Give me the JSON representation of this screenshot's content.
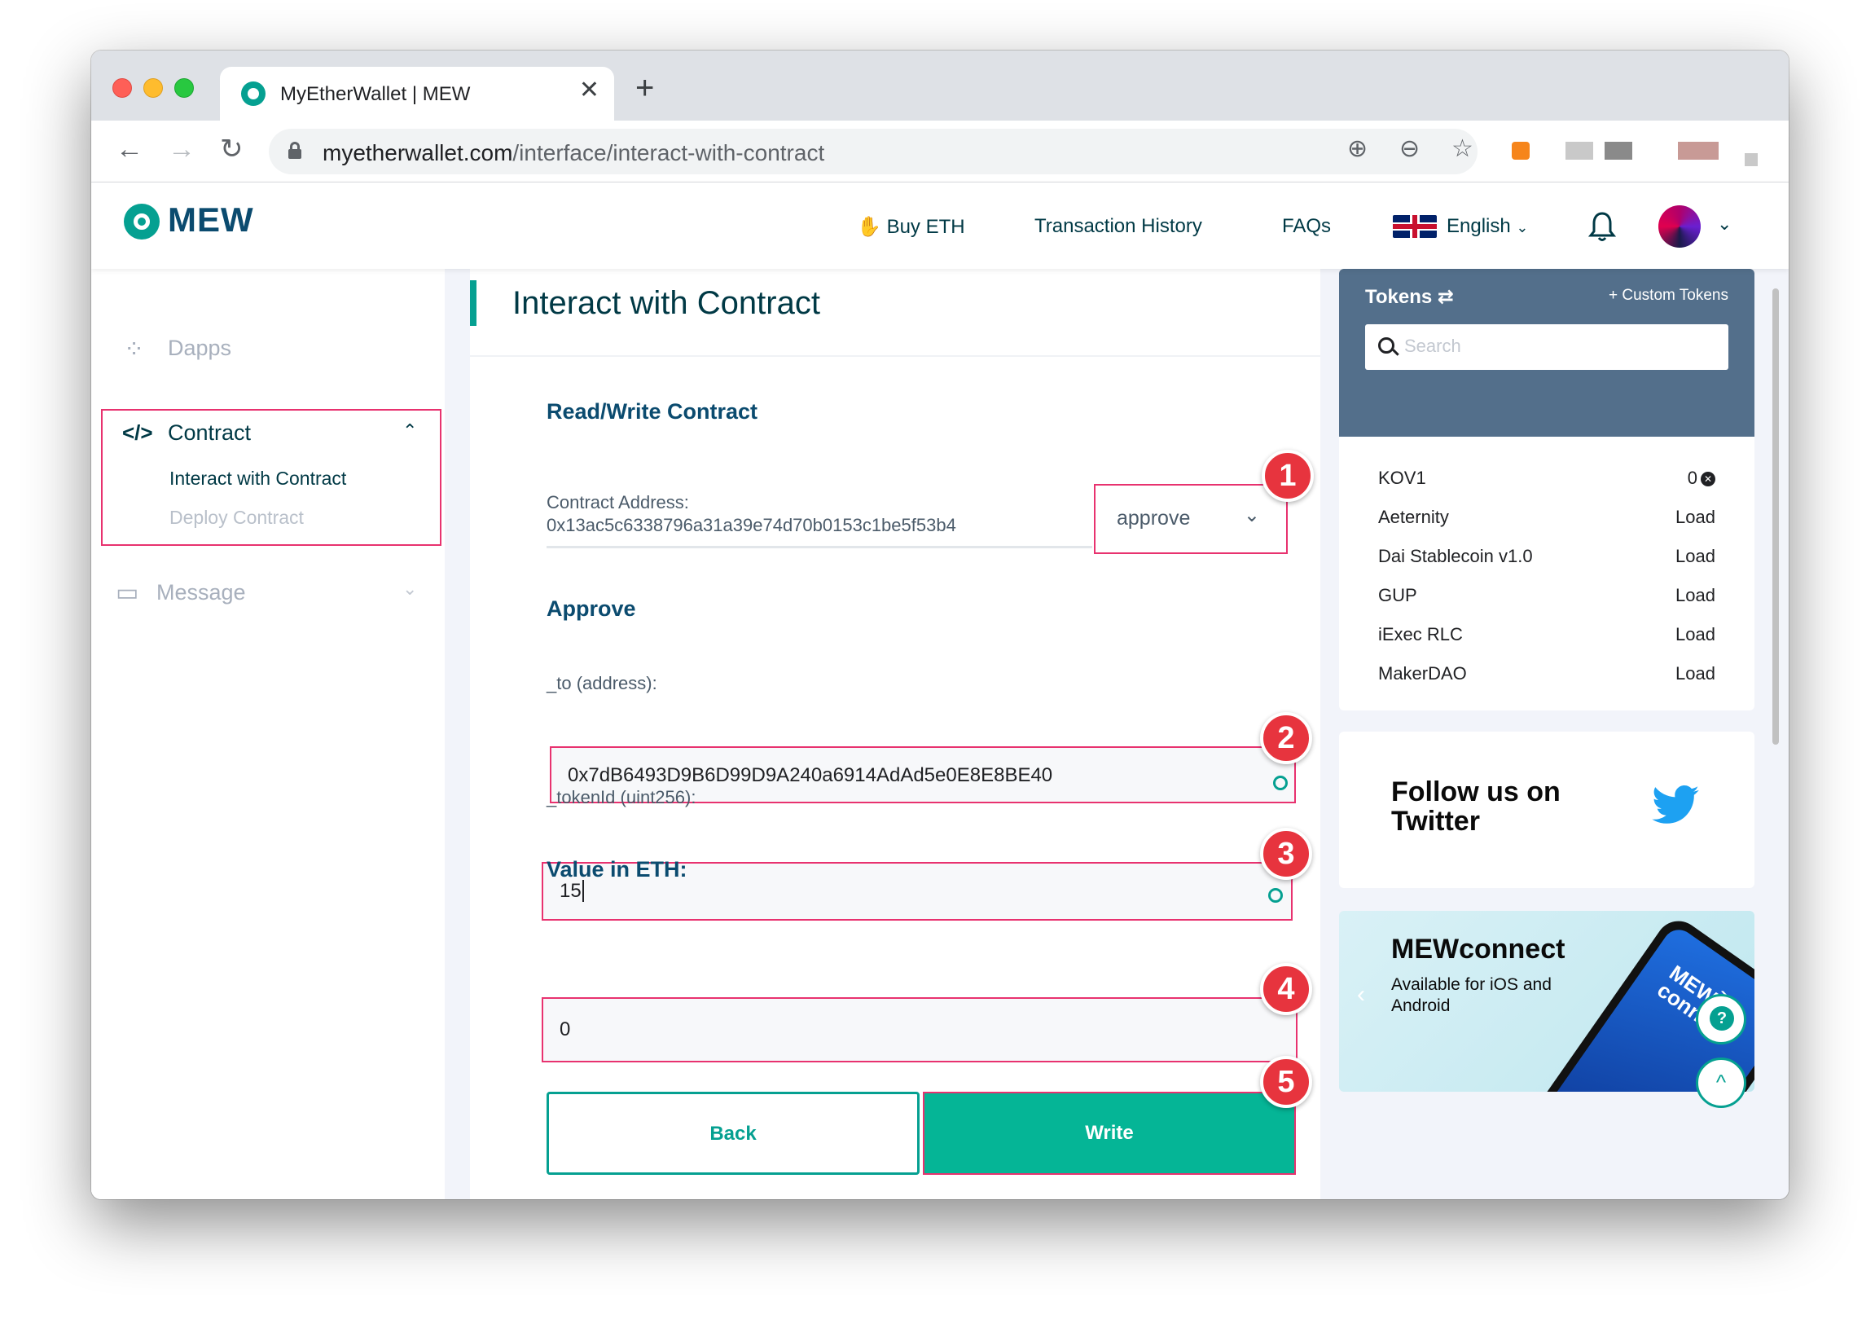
{
  "browser": {
    "tab_title": "MyEtherWallet | MEW",
    "tab_close": "✕",
    "new_tab": "+",
    "url_host": "myetherwallet.com",
    "url_path": "/interface/interact-with-contract"
  },
  "header": {
    "logo_text": "MEW",
    "buy_eth": "Buy ETH",
    "transaction_history": "Transaction History",
    "faqs": "FAQs",
    "language": "English"
  },
  "sidebar": {
    "dapps": "Dapps",
    "contract": "Contract",
    "interact_with_contract": "Interact with Contract",
    "deploy_contract": "Deploy Contract",
    "message": "Message"
  },
  "main": {
    "title": "Interact with Contract",
    "read_write_heading": "Read/Write Contract",
    "contract_address_label": "Contract Address:",
    "contract_address_value": "0x13ac5c6338796a31a39e74d70b0153c1be5f53b4",
    "function_select": "approve",
    "function_heading": "Approve",
    "to_label": "_to (address):",
    "to_value": "0x7dB6493D9B6D99D9A240a6914AdAd5e0E8E8BE40",
    "token_id_label": "_tokenId (uint256):",
    "token_id_value": "15",
    "value_label": "Value in ETH:",
    "value_value": "0",
    "back_button": "Back",
    "write_button": "Write",
    "badges": [
      "1",
      "2",
      "3",
      "4",
      "5"
    ]
  },
  "tokens": {
    "title": "Tokens",
    "custom_tokens": "+ Custom Tokens",
    "search_placeholder": "Search",
    "list": [
      {
        "name": "KOV1",
        "value": "0"
      },
      {
        "name": "Aeternity",
        "value": "Load"
      },
      {
        "name": "Dai Stablecoin v1.0",
        "value": "Load"
      },
      {
        "name": "GUP",
        "value": "Load"
      },
      {
        "name": "iExec RLC",
        "value": "Load"
      },
      {
        "name": "MakerDAO",
        "value": "Load"
      }
    ]
  },
  "twitter": {
    "line1": "Follow us on",
    "line2": "Twitter"
  },
  "mewconnect": {
    "title": "MEWconnect",
    "subtitle": "Available for iOS and Android",
    "phone_text": "MEW connect"
  },
  "colors": {
    "brand_teal": "#05a091",
    "write_green": "#05b596",
    "annotation_red": "#e8326f",
    "badge_red": "#e7343e",
    "tokens_header": "#536f8b",
    "navy_text": "#0b4b6f"
  },
  "icons": {
    "help": "?",
    "scroll_top": "^"
  }
}
